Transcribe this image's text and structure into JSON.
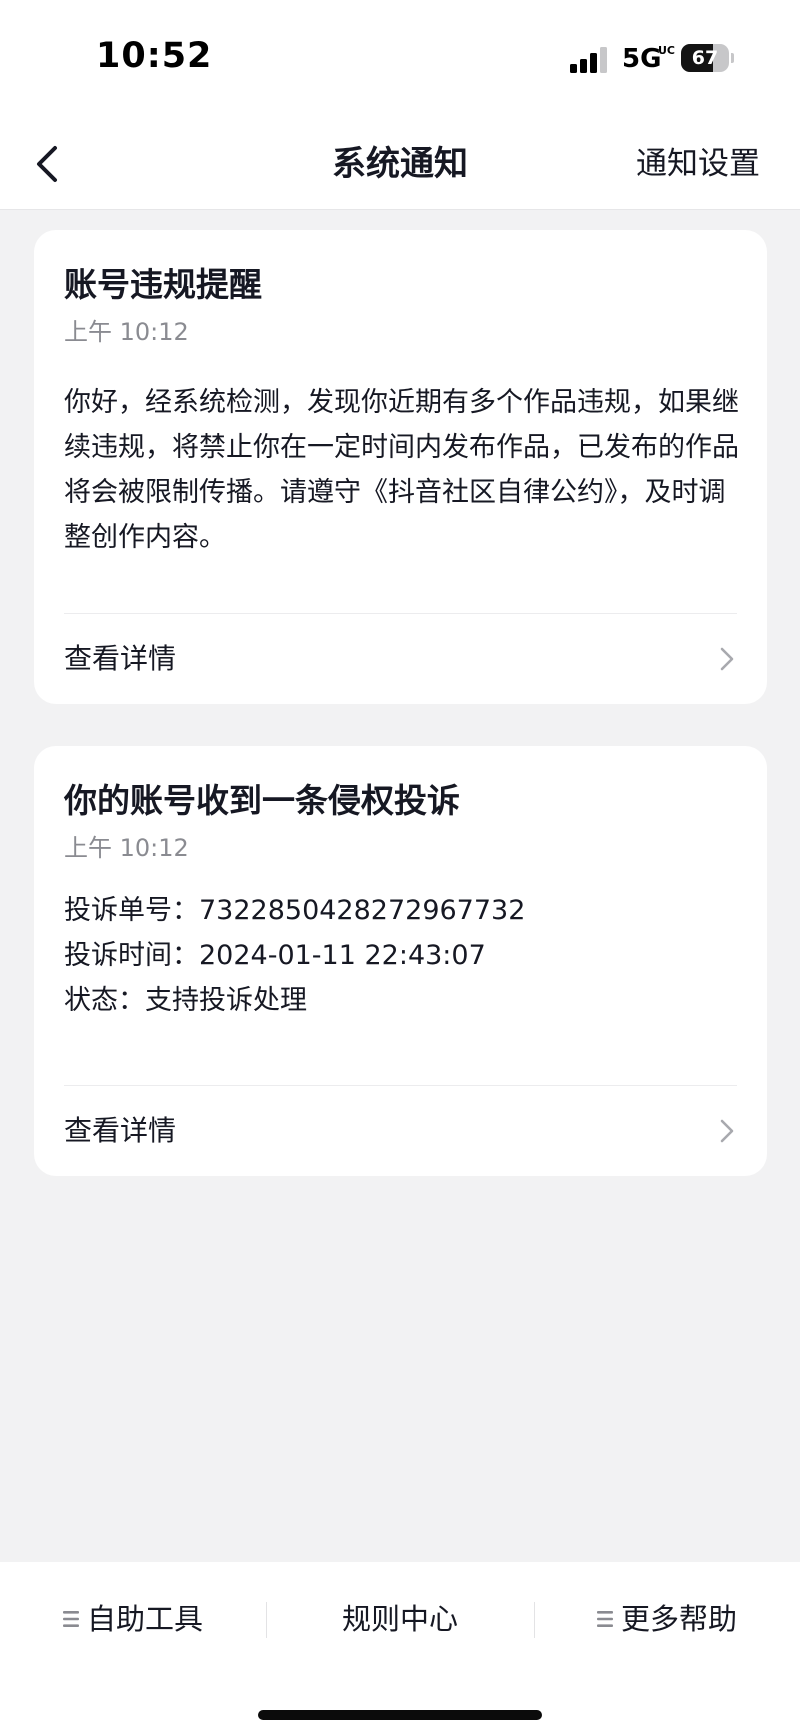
{
  "status_bar": {
    "time": "10:52",
    "network": "5G",
    "network_sub": "UC",
    "battery_level": "67",
    "battery_percent": 67
  },
  "nav": {
    "title": "系统通知",
    "settings_label": "通知设置",
    "back_icon": "chevron-left-icon"
  },
  "notifications": [
    {
      "title": "账号违规提醒",
      "time": "上午 10:12",
      "body": "你好，经系统检测，发现你近期有多个作品违规，如果继续违规，将禁止你在一定时间内发布作品，已发布的作品将会被限制传播。请遵守《抖音社区自律公约》，及时调整创作内容。",
      "action_label": "查看详情"
    },
    {
      "title": "你的账号收到一条侵权投诉",
      "time": "上午 10:12",
      "lines": [
        "投诉单号：7322850428272967732",
        "投诉时间：2024-01-11 22:43:07",
        "状态：支持投诉处理"
      ],
      "action_label": "查看详情"
    }
  ],
  "bottom_bar": {
    "items": [
      {
        "label": "自助工具",
        "icon": "menu-icon"
      },
      {
        "label": "规则中心"
      },
      {
        "label": "更多帮助",
        "icon": "menu-icon"
      }
    ]
  },
  "colors": {
    "background": "#f2f2f3",
    "card": "#ffffff",
    "text_primary": "#161823",
    "text_secondary": "#8a8b91"
  }
}
